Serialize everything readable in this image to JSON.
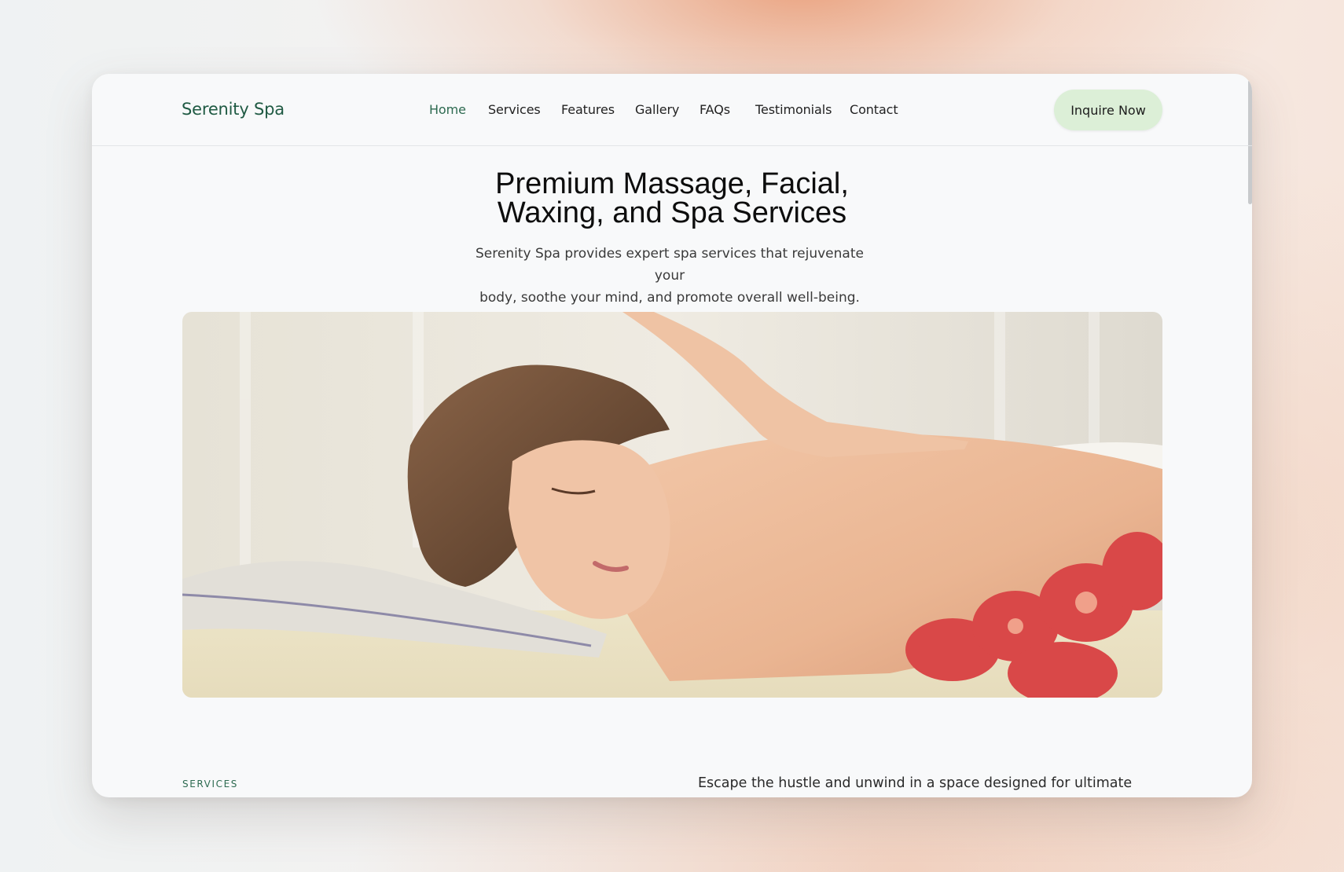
{
  "brand": {
    "name": "Serenity Spa"
  },
  "nav": {
    "items": [
      {
        "label": "Home",
        "active": true
      },
      {
        "label": "Services",
        "active": false
      },
      {
        "label": "Features",
        "active": false
      },
      {
        "label": "Gallery",
        "active": false
      },
      {
        "label": "FAQs",
        "active": false
      },
      {
        "label": "Testimonials",
        "active": false
      },
      {
        "label": "Contact",
        "active": false
      }
    ],
    "cta_label": "Inquire Now"
  },
  "hero": {
    "title_line1": "Premium Massage, Facial,",
    "title_line2": "Waxing, and Spa Services",
    "subtitle_line1": "Serenity Spa provides expert spa services that rejuvenate your",
    "subtitle_line2": "body, soothe your mind, and promote overall well-being."
  },
  "services_section": {
    "tag": "SERVICES",
    "intro": "Escape the hustle and unwind in a space designed for ultimate"
  },
  "colors": {
    "brand_green": "#1f5a43",
    "active_nav": "#2d6a50",
    "cta_bg": "#dcefd7",
    "page_bg": "#f8f9fa"
  }
}
